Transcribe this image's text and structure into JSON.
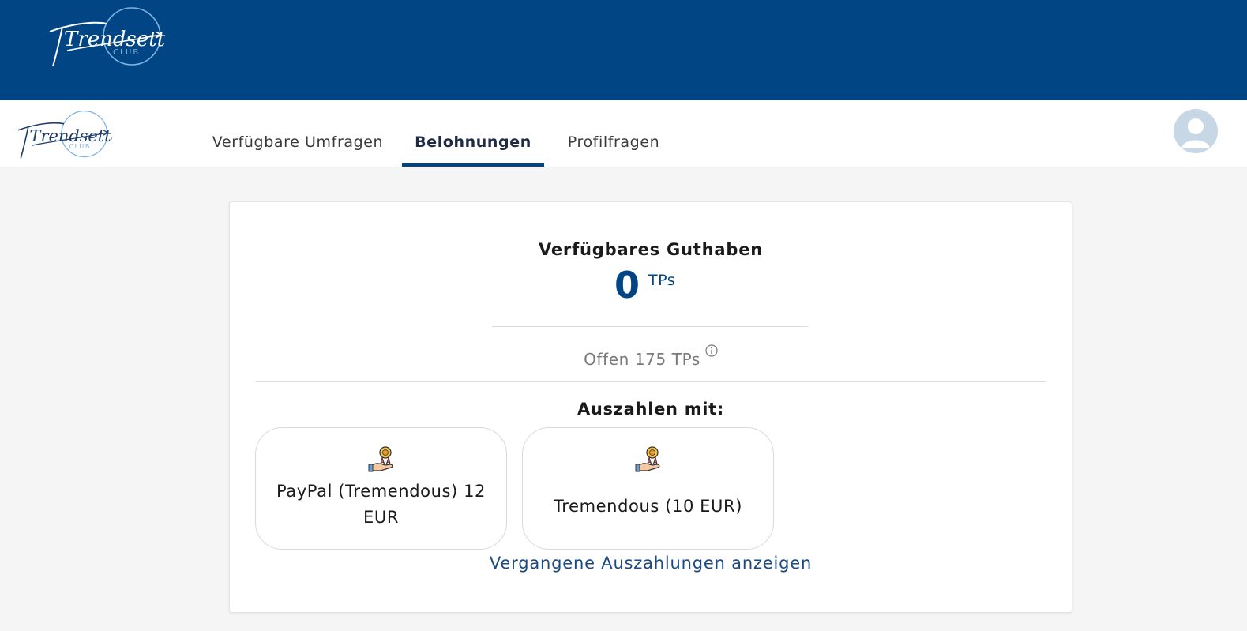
{
  "header": {
    "logo_icon": "trendsetter-club-logo",
    "logo_wordmark": "Trendsetter",
    "logo_sub": "CLUB"
  },
  "nav": {
    "tabs": [
      {
        "label": "Verfügbare Umfragen",
        "active": false
      },
      {
        "label": "Belohnungen",
        "active": true
      },
      {
        "label": "Profilfragen",
        "active": false
      }
    ],
    "avatar_icon": "user-avatar-icon"
  },
  "balance": {
    "title": "Verfügbares Guthaben",
    "value": "0",
    "unit": "TPs",
    "pending": "Offen 175 TPs",
    "info_icon": "info-icon"
  },
  "payout": {
    "heading": "Auszahlen mit:",
    "options": [
      {
        "label": "PayPal (Tremendous) 12 EUR",
        "icon": "reward-hand-icon"
      },
      {
        "label": "Tremendous (10 EUR)",
        "icon": "reward-hand-icon"
      }
    ],
    "history_link": "Vergangene Auszahlungen anzeigen"
  },
  "colors": {
    "brand_blue": "#024584",
    "avatar_bg": "#c7d7e6",
    "page_bg": "#f5f5f5"
  }
}
